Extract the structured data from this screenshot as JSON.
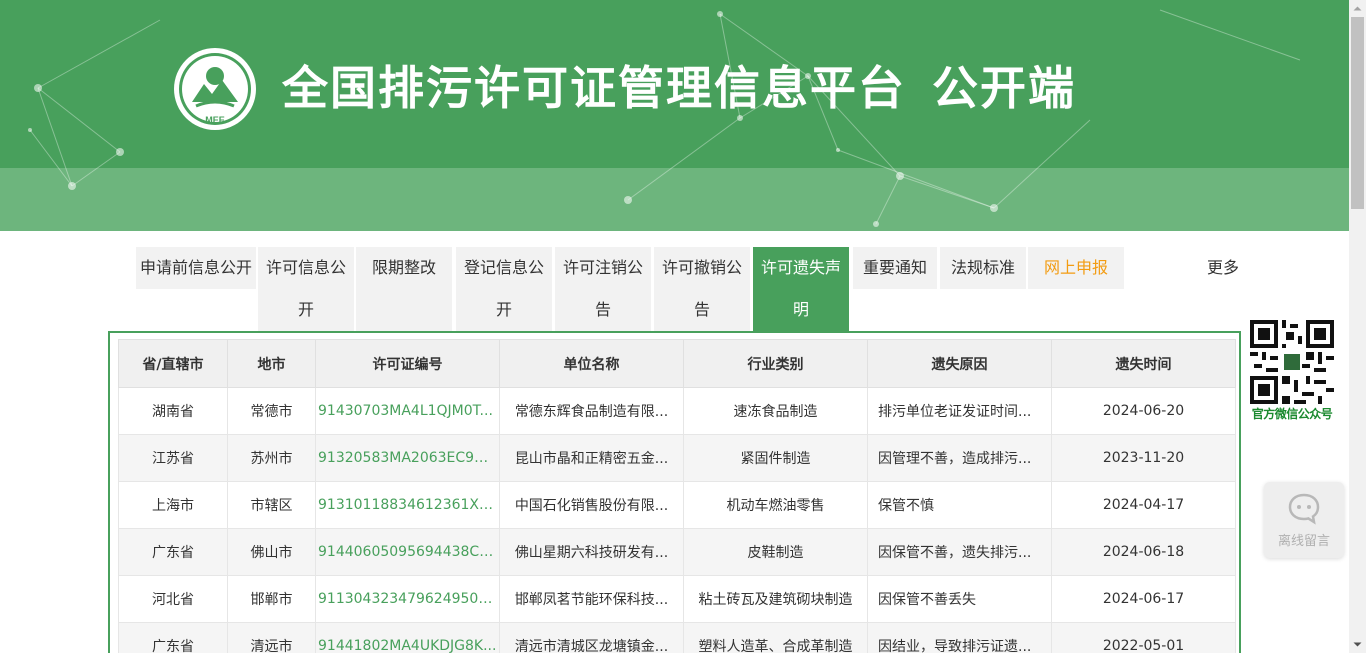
{
  "header": {
    "logo_text": "MEE",
    "title": "全国排污许可证管理信息平台",
    "subtitle": "公开端",
    "colors": {
      "banner": "#48a05c",
      "banner_lower": "#6db57d"
    }
  },
  "tabs": [
    {
      "label": "申请前信息公开",
      "active": false
    },
    {
      "label": "许可信息公开",
      "active": false
    },
    {
      "label": "限期整改",
      "active": false
    },
    {
      "label": "登记信息公开",
      "active": false
    },
    {
      "label": "许可注销公告",
      "active": false
    },
    {
      "label": "许可撤销公告",
      "active": false
    },
    {
      "label": "许可遗失声明",
      "active": true
    },
    {
      "label": "重要通知",
      "active": false
    },
    {
      "label": "法规标准",
      "active": false
    },
    {
      "label": "网上申报",
      "active": false,
      "highlight": "#f39c12"
    }
  ],
  "more_label": "更多",
  "qr": {
    "label": "官方微信公众号",
    "icon": "qr-code-icon"
  },
  "table": {
    "headers": [
      "省/直辖市",
      "地市",
      "许可证编号",
      "单位名称",
      "行业类别",
      "遗失原因",
      "遗失时间"
    ],
    "rows": [
      [
        "湖南省",
        "常德市",
        "91430703MA4L1QJM0T...",
        "常德东辉食品制造有限...",
        "速冻食品制造",
        "排污单位老证发证时间...",
        "2024-06-20"
      ],
      [
        "江苏省",
        "苏州市",
        "91320583MA2063EC9C...",
        "昆山市晶和正精密五金...",
        "紧固件制造",
        "因管理不善，造成排污...",
        "2023-11-20"
      ],
      [
        "上海市",
        "市辖区",
        "91310118834612361X0...",
        "中国石化销售股份有限...",
        "机动车燃油零售",
        "保管不慎",
        "2024-04-17"
      ],
      [
        "广东省",
        "佛山市",
        "91440605095694438C0...",
        "佛山星期六科技研发有...",
        "皮鞋制造",
        "因保管不善，遗失排污...",
        "2024-06-18"
      ],
      [
        "河北省",
        "邯郸市",
        "9113043234796249500...",
        "邯郸凤茗节能环保科技...",
        "粘土砖瓦及建筑砌块制造",
        "因保管不善丢失",
        "2024-06-17"
      ],
      [
        "广东省",
        "清远市",
        "91441802MA4UKDJG8K...",
        "清远市清城区龙塘镇金...",
        "塑料人造革、合成革制造",
        "因结业，导致排污证遗...",
        "2022-05-01"
      ]
    ]
  },
  "message_widget": {
    "label": "离线留言",
    "icon": "chat-bubble-icon"
  },
  "scrollbar": {
    "thumb_fraction": 0.31
  }
}
